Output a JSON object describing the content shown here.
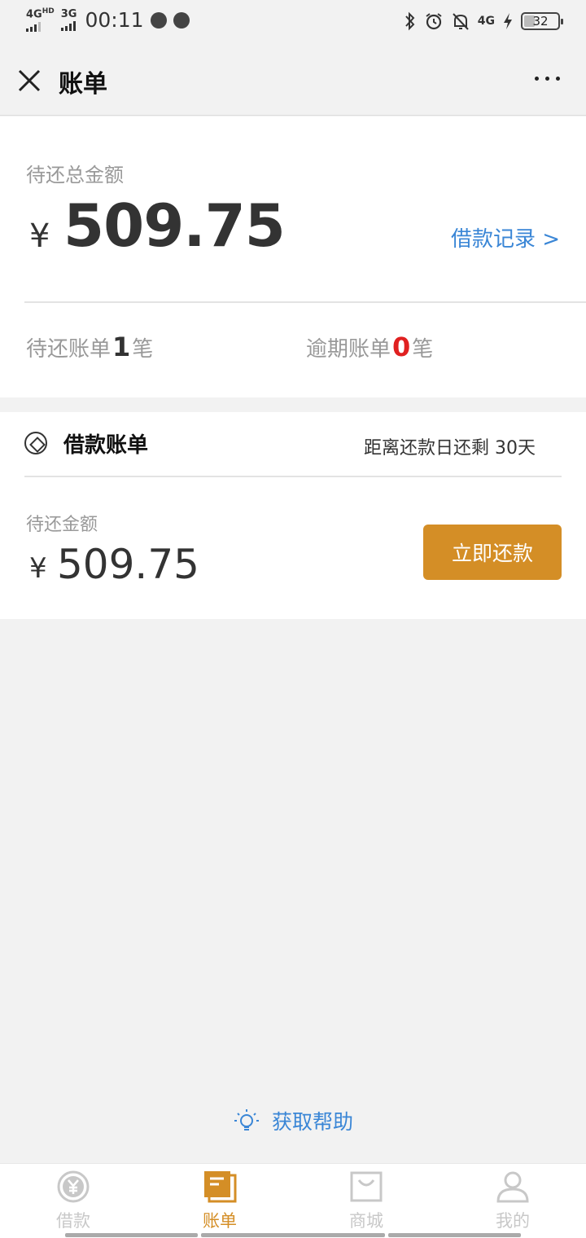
{
  "status_bar": {
    "network1": "4G",
    "network1_sup": "HD",
    "network2": "3G",
    "time": "00:11",
    "network3": "4G",
    "battery": "32"
  },
  "nav": {
    "title": "账单"
  },
  "summary": {
    "total_label": "待还总金额",
    "currency": "¥",
    "total_amount": "509.75",
    "records_link": "借款记录 >",
    "pending_prefix": "待还账单",
    "pending_count": "1",
    "pending_suffix": "笔",
    "overdue_prefix": "逾期账单",
    "overdue_count": "0",
    "overdue_suffix": "笔"
  },
  "bill": {
    "title": "借款账单",
    "due_text": "距离还款日还剩 30天",
    "amount_label": "待还金额",
    "currency": "¥",
    "amount": "509.75",
    "repay_button": "立即还款"
  },
  "help": {
    "label": "获取帮助"
  },
  "tabs": [
    {
      "label": "借款",
      "icon": "yen-circle-icon"
    },
    {
      "label": "账单",
      "icon": "bill-icon"
    },
    {
      "label": "商城",
      "icon": "shopping-bag-icon"
    },
    {
      "label": "我的",
      "icon": "user-icon"
    }
  ],
  "colors": {
    "accent": "#d48e26",
    "link": "#3a86d6",
    "overdue": "#e02020",
    "inactive_tab": "#c8c8c8"
  }
}
